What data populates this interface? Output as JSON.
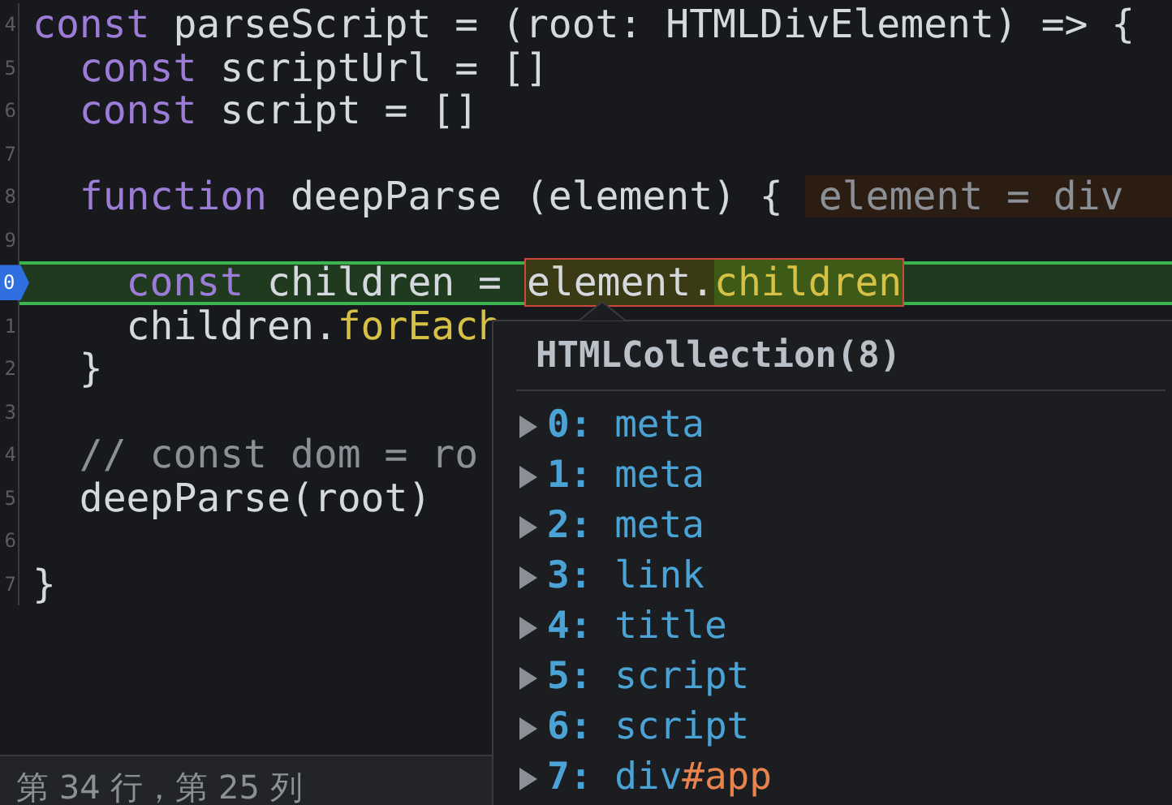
{
  "editor": {
    "lines": [
      {
        "number": "4",
        "tokens": [
          {
            "kind": "keyword",
            "text": "const"
          },
          {
            "kind": "plain",
            "text": " parseScript = (root: HTMLDivElement) => {"
          }
        ]
      },
      {
        "number": "5",
        "tokens": [
          {
            "kind": "keyword",
            "text": "  const"
          },
          {
            "kind": "plain",
            "text": " scriptUrl = []"
          }
        ]
      },
      {
        "number": "6",
        "tokens": [
          {
            "kind": "keyword",
            "text": "  const"
          },
          {
            "kind": "plain",
            "text": " script = []"
          }
        ]
      },
      {
        "number": "7"
      },
      {
        "number": "8",
        "tokens": [
          {
            "kind": "keyword",
            "text": "  function"
          },
          {
            "kind": "plain",
            "text": " deepParse (element) {"
          }
        ],
        "inline_value": "element = div"
      },
      {
        "number": "9"
      },
      {
        "number": "0",
        "breakpoint": true,
        "highlighted": true,
        "tokens": [
          {
            "kind": "keyword",
            "text": "    const"
          },
          {
            "kind": "plain",
            "text": " children = "
          },
          {
            "kind": "eval_object",
            "text": "element."
          },
          {
            "kind": "eval_property",
            "text": "children"
          }
        ]
      },
      {
        "number": "1",
        "tokens": [
          {
            "kind": "plain",
            "text": "    children."
          },
          {
            "kind": "method",
            "text": "forEach"
          }
        ]
      },
      {
        "number": "2",
        "tokens": [
          {
            "kind": "plain",
            "text": "  }"
          }
        ]
      },
      {
        "number": "3"
      },
      {
        "number": "4",
        "tokens": [
          {
            "kind": "comment",
            "text": "  // const dom = ro"
          }
        ]
      },
      {
        "number": "5",
        "tokens": [
          {
            "kind": "plain",
            "text": "  deepParse(root)"
          }
        ]
      },
      {
        "number": "6"
      },
      {
        "number": "7",
        "tokens": [
          {
            "kind": "plain",
            "text": "}"
          }
        ]
      }
    ]
  },
  "popup": {
    "title": "HTMLCollection(8)",
    "items": [
      {
        "index": "0:",
        "tag": "meta"
      },
      {
        "index": "1:",
        "tag": "meta"
      },
      {
        "index": "2:",
        "tag": "meta"
      },
      {
        "index": "3:",
        "tag": "link"
      },
      {
        "index": "4:",
        "tag": "title"
      },
      {
        "index": "5:",
        "tag": "script"
      },
      {
        "index": "6:",
        "tag": "script"
      },
      {
        "index": "7:",
        "tag": "div",
        "suffix": "#app"
      }
    ]
  },
  "status_bar": {
    "position": "第 34 行，第 25 列"
  }
}
